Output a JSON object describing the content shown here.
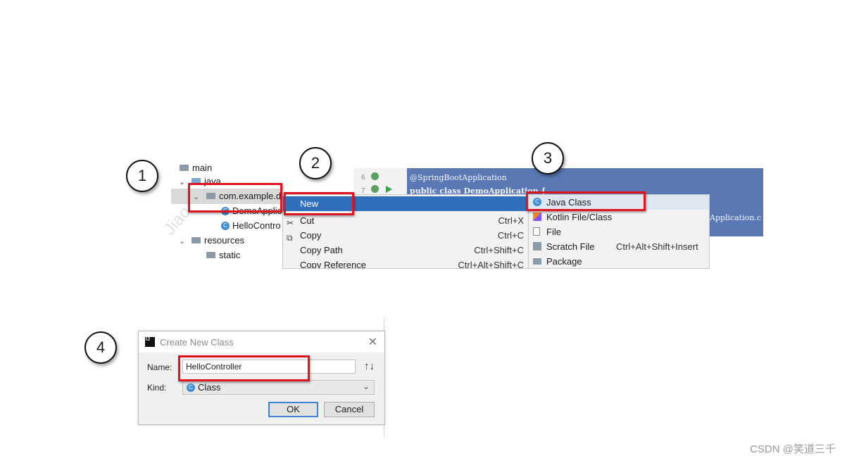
{
  "badges": [
    "1",
    "2",
    "3",
    "4"
  ],
  "tree": {
    "main": "main",
    "java": "java",
    "package": "com.example.d",
    "demo_app": "DemoApplic",
    "hello": "HelloContro",
    "resources": "resources",
    "static": "static"
  },
  "editor": {
    "lines": [
      "6",
      "7"
    ],
    "annotation": "@SpringBootApplication",
    "class_decl": "public class DemoApplication {",
    "run_fragment": "Application.c"
  },
  "context_menu": {
    "items": [
      {
        "label": "New",
        "shortcut": ""
      },
      {
        "label": "Cut",
        "shortcut": "Ctrl+X"
      },
      {
        "label": "Copy",
        "shortcut": "Ctrl+C"
      },
      {
        "label": "Copy Path",
        "shortcut": "Ctrl+Shift+C"
      },
      {
        "label": "Copy Reference",
        "shortcut": "Ctrl+Alt+Shift+C"
      }
    ]
  },
  "submenu": {
    "items": [
      {
        "label": "Java Class",
        "shortcut": ""
      },
      {
        "label": "Kotlin File/Class",
        "shortcut": ""
      },
      {
        "label": "File",
        "shortcut": ""
      },
      {
        "label": "Scratch File",
        "shortcut": "Ctrl+Alt+Shift+Insert"
      },
      {
        "label": "Package",
        "shortcut": ""
      }
    ]
  },
  "dialog": {
    "logo": "IJ",
    "title": "Create New Class",
    "close": "✕",
    "name_label": "Name:",
    "name_value": "HelloController",
    "kind_label": "Kind:",
    "kind_value": "Class",
    "ok": "OK",
    "cancel": "Cancel"
  },
  "watermark": "CSDN @笑道三千",
  "colors": {
    "highlight": "#e0141e",
    "selection": "#2f6fbb",
    "editor_bg": "#5a79b4"
  }
}
